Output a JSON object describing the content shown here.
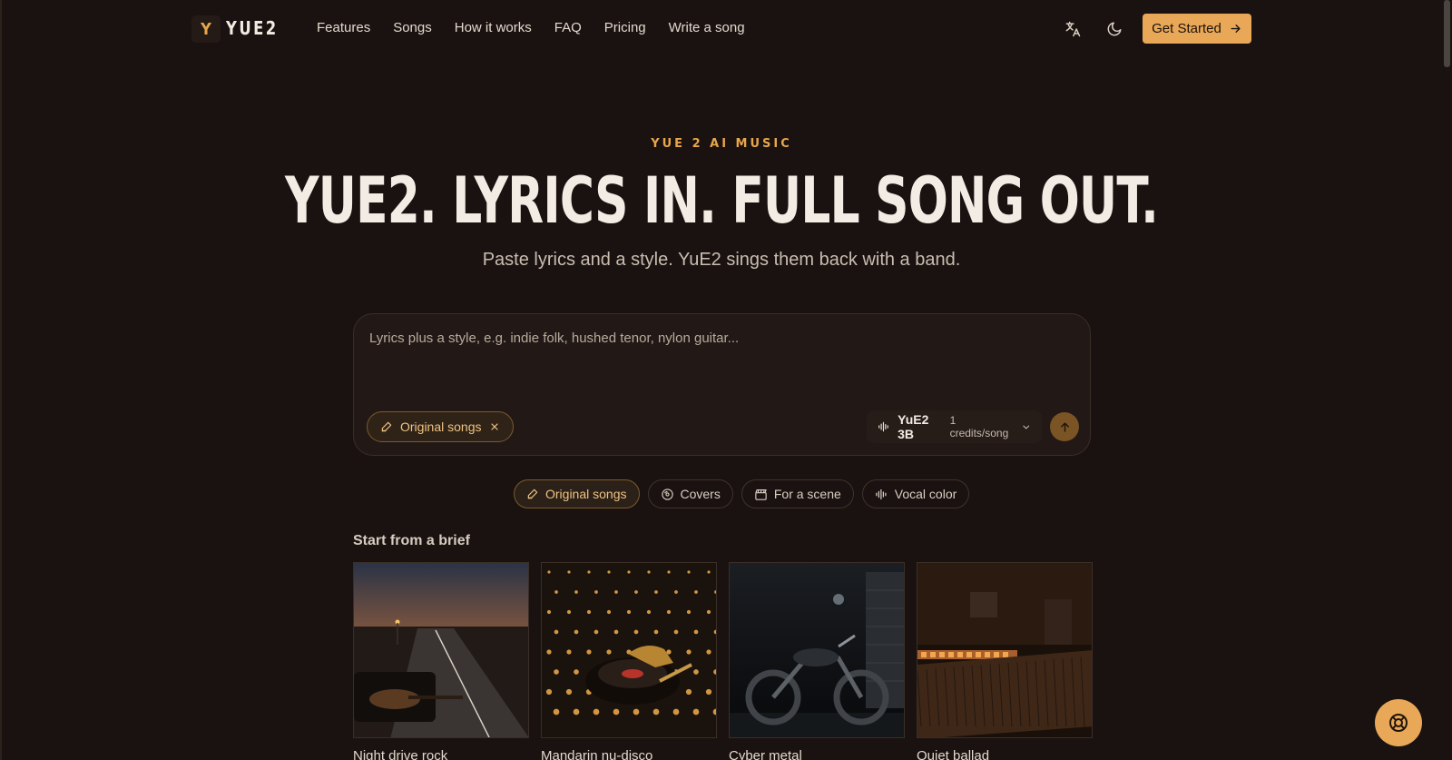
{
  "header": {
    "logo_letter": "Y",
    "logo_text": "YUE2",
    "nav": [
      "Features",
      "Songs",
      "How it works",
      "FAQ",
      "Pricing",
      "Write a song"
    ],
    "translate_icon": "translate-icon",
    "theme_icon": "moon-icon",
    "cta_label": "Get Started"
  },
  "hero": {
    "eyebrow": "YUE 2 AI MUSIC",
    "title": "YUE2. LYRICS IN. FULL SONG OUT.",
    "subtitle": "Paste lyrics and a style. YuE2 sings them back with a band."
  },
  "prompt": {
    "placeholder": "Lyrics plus a style, e.g. indie folk, hushed tenor, nylon guitar...",
    "value": "",
    "active_mode_chip": "Original songs",
    "model_name": "YuE2 3B",
    "model_credits": "1 credits/song"
  },
  "modes": [
    {
      "label": "Original songs",
      "icon": "pen-icon",
      "active": true
    },
    {
      "label": "Covers",
      "icon": "vinyl-icon",
      "active": false
    },
    {
      "label": "For a scene",
      "icon": "clapperboard-icon",
      "active": false
    },
    {
      "label": "Vocal color",
      "icon": "waveform-icon",
      "active": false
    }
  ],
  "briefs": {
    "heading": "Start from a brief",
    "items": [
      {
        "title": "Night drive rock"
      },
      {
        "title": "Mandarin nu-disco"
      },
      {
        "title": "Cyber metal"
      },
      {
        "title": "Quiet ballad"
      }
    ]
  },
  "colors": {
    "background": "#1a1210",
    "accent": "#e9a857",
    "text": "#f3ece4"
  }
}
